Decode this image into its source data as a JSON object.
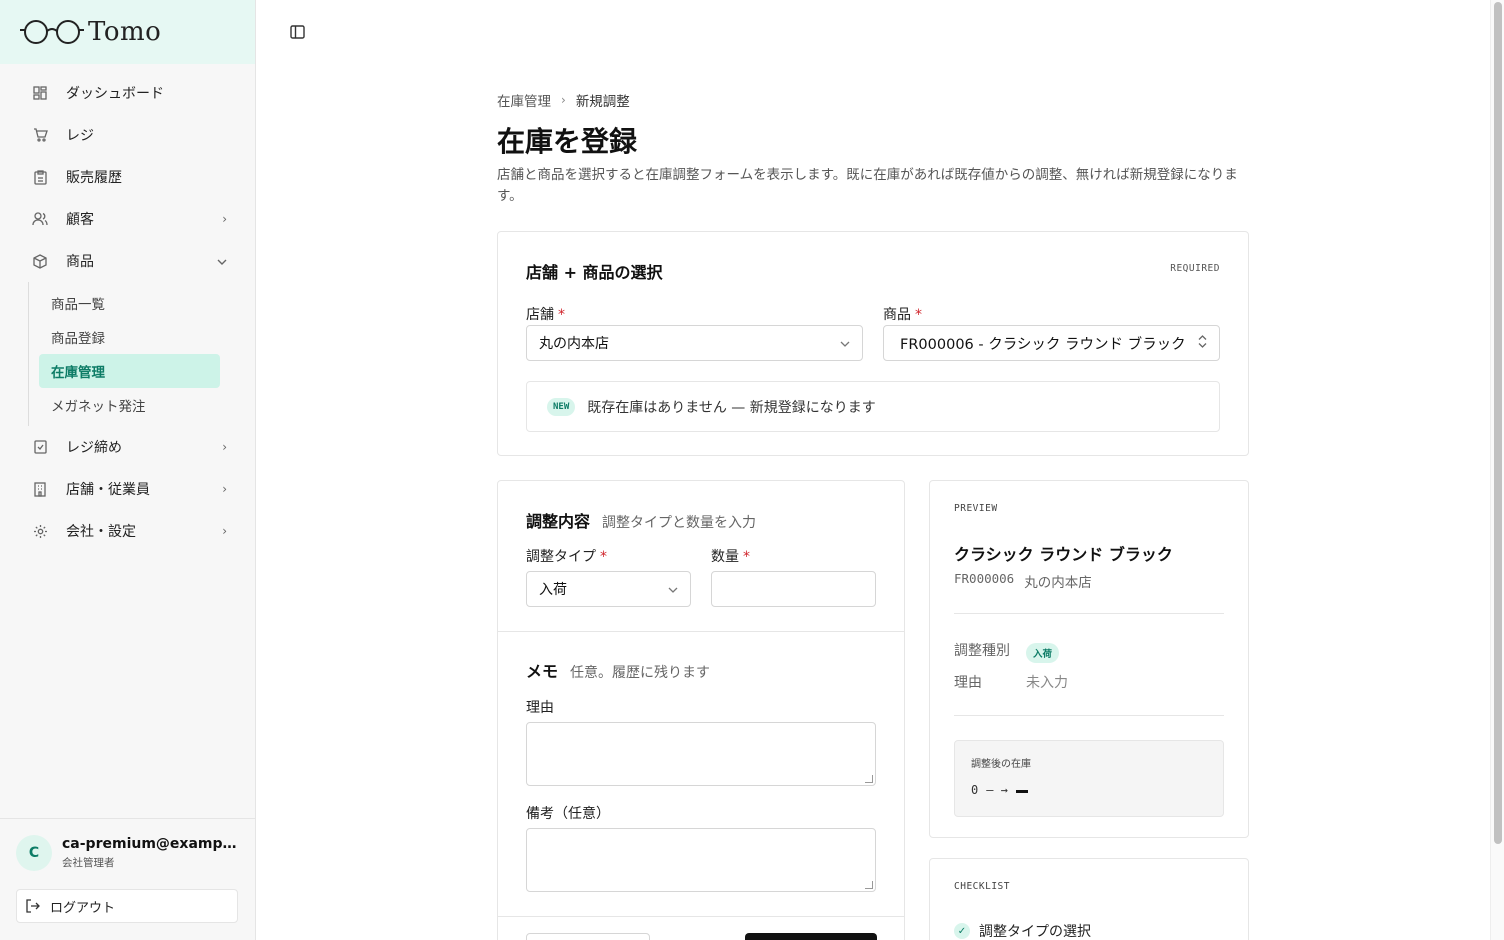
{
  "app": {
    "name": "Tomo"
  },
  "sidebar": {
    "items": [
      {
        "label": "ダッシュボード",
        "icon": "dashboard-icon"
      },
      {
        "label": "レジ",
        "icon": "cart-icon"
      },
      {
        "label": "販売履歴",
        "icon": "clipboard-icon"
      },
      {
        "label": "顧客",
        "icon": "users-icon",
        "chevron": "right"
      },
      {
        "label": "商品",
        "icon": "box-icon",
        "chevron": "down"
      },
      {
        "label": "レジ締め",
        "icon": "register-close-icon",
        "chevron": "right"
      },
      {
        "label": "店舗・従業員",
        "icon": "building-icon",
        "chevron": "right"
      },
      {
        "label": "会社・設定",
        "icon": "gear-icon",
        "chevron": "right"
      }
    ],
    "products_sub": [
      {
        "label": "商品一覧",
        "active": false
      },
      {
        "label": "商品登録",
        "active": false
      },
      {
        "label": "在庫管理",
        "active": true
      },
      {
        "label": "メガネット発注",
        "active": false
      }
    ],
    "user": {
      "initial": "C",
      "email": "ca-premium@example.com",
      "role": "会社管理者"
    },
    "logout_label": "ログアウト"
  },
  "breadcrumb": {
    "parent": "在庫管理",
    "current": "新規調整"
  },
  "page": {
    "title": "在庫を登録",
    "description": "店舗と商品を選択すると在庫調整フォームを表示します。既に在庫があれば既存値からの調整、無ければ新規登録になります。"
  },
  "select_card": {
    "title": "店舗 + 商品の選択",
    "required_tag": "REQUIRED",
    "store_label": "店舗",
    "store_value": "丸の内本店",
    "product_label": "商品",
    "product_value": "FR000006 - クラシック ラウンド ブラック",
    "notice_badge": "NEW",
    "notice_text": "既存在庫はありません — 新規登録になります"
  },
  "adjust_card": {
    "title": "調整内容",
    "subtitle": "調整タイプと数量を入力",
    "type_label": "調整タイプ",
    "type_value": "入荷",
    "qty_label": "数量",
    "qty_value": "",
    "memo_title": "メモ",
    "memo_subtitle": "任意。履歴に残ります",
    "reason_label": "理由",
    "note_label": "備考（任意）"
  },
  "preview": {
    "tag": "PREVIEW",
    "product_name": "クラシック ラウンド ブラック",
    "product_code": "FR000006",
    "store": "丸の内本店",
    "type_key": "調整種別",
    "type_badge": "入荷",
    "reason_key": "理由",
    "reason_value": "未入力",
    "stock_label": "調整後の在庫",
    "stock_before": "0",
    "stock_arrow": "— →"
  },
  "checklist": {
    "tag": "CHECKLIST",
    "items": [
      {
        "label": "調整タイプの選択",
        "done": true
      }
    ]
  },
  "colors": {
    "accent": "#0d7c66",
    "accent_bg": "#cdf3e8",
    "logo_bg": "#e6f8f3",
    "required": "#d0242b"
  }
}
